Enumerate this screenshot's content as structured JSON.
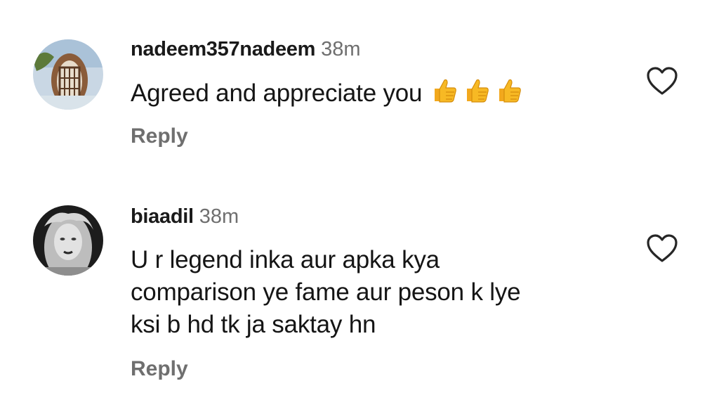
{
  "comments": [
    {
      "username": "nadeem357nadeem",
      "time": "38m",
      "text": "Agreed and appreciate you",
      "emoji_icon": "thumbs-up-icon",
      "emoji_count": 3,
      "reply_label": "Reply",
      "like_icon": "heart-outline-icon"
    },
    {
      "username": "biaadil",
      "time": "38m",
      "text_lines": [
        "U r legend inka aur apka kya",
        "comparison ye fame aur peson k lye",
        "ksi b hd tk ja saktay hn"
      ],
      "reply_label": "Reply",
      "like_icon": "heart-outline-icon"
    }
  ],
  "colors": {
    "text": "#151515",
    "secondary": "#6f6f6f",
    "emoji": "#f7b924"
  }
}
